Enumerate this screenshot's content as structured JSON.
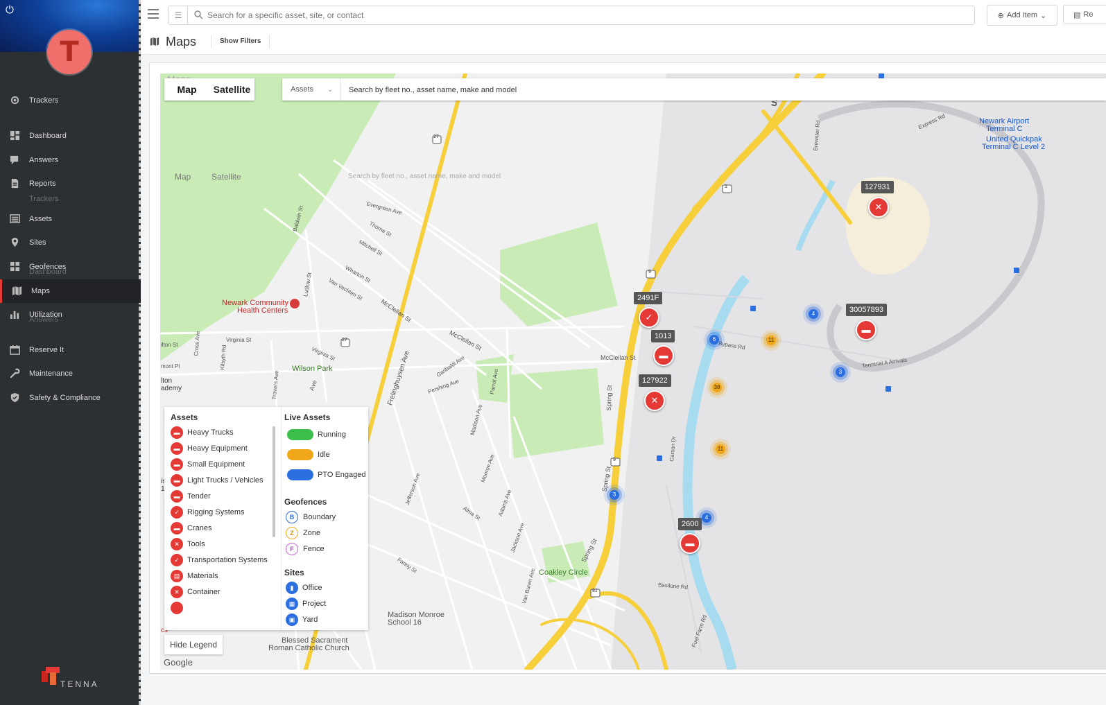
{
  "sidebar": {
    "user_initial": "T",
    "items": [
      {
        "label": "Trackers",
        "icon": "gear-icon"
      },
      {
        "label": "Dashboard",
        "icon": "dashboard-icon"
      },
      {
        "label": "Answers",
        "icon": "chat-icon"
      },
      {
        "label": "Reports",
        "icon": "report-icon"
      },
      {
        "label": "Assets",
        "icon": "assets-icon"
      },
      {
        "label": "Sites",
        "icon": "location-pin-icon"
      },
      {
        "label": "Geofences",
        "icon": "geofence-icon"
      },
      {
        "label": "Maps",
        "icon": "map-icon",
        "active": true
      },
      {
        "label": "Utilization",
        "icon": "chart-icon"
      },
      {
        "label": "Reserve It",
        "icon": "calendar-icon"
      },
      {
        "label": "Maintenance",
        "icon": "wrench-icon"
      },
      {
        "label": "Safety & Compliance",
        "icon": "shield-icon"
      }
    ],
    "ghosts": [
      "Trackers",
      "Dashboard",
      "Answers"
    ],
    "brand": "TENNA"
  },
  "topbar": {
    "search_placeholder": "Search for a specific asset, site, or contact",
    "add_item_label": "Add Item",
    "report_label": "Re"
  },
  "page": {
    "title": "Maps",
    "show_filters_label": "Show Filters"
  },
  "map": {
    "toggle": {
      "map": "Map",
      "satellite": "Satellite"
    },
    "asset_select": "Assets",
    "search_placeholder": "Search by fleet no., asset name, make and model",
    "ghost_text": {
      "maps": "Maps",
      "map": "Map",
      "satellite": "Satellite",
      "search": "Search by fleet no., asset name, make and model"
    },
    "tags": [
      "127931",
      "2491F",
      "1013",
      "127922",
      "30057893",
      "2600"
    ],
    "clusters": [
      {
        "value": "4",
        "color": "blue"
      },
      {
        "value": "6",
        "color": "blue"
      },
      {
        "value": "11",
        "color": "amber"
      },
      {
        "value": "3",
        "color": "blue"
      },
      {
        "value": "38",
        "color": "amber"
      },
      {
        "value": "11",
        "color": "amber"
      },
      {
        "value": "3",
        "color": "blue"
      },
      {
        "value": "4",
        "color": "blue"
      }
    ],
    "places": {
      "newark_community": "Newark Community",
      "health_centers": "Health Centers",
      "wilson_park": "Wilson Park",
      "coakley": "Coakley Circle",
      "madison1": "Madison Monroe",
      "madison2": "School 16",
      "blessed1": "Blessed Sacrament",
      "blessed2": "Roman Catholic Church",
      "airport1": "Newark Airport",
      "airport2": "Terminal C",
      "quickpak1": "United Quickpak",
      "quickpak2": "Terminal C Level 2",
      "hilton1": "lton",
      "hilton2": "ademy",
      "montpl": "mont Pl",
      "hilton_st": "ilton St",
      "is": "is",
      "num18": "18",
      "cs": "cs"
    },
    "streets": {
      "frelinghuysen": "Frelinghuysen Ave",
      "mcclellan": "McClellan St",
      "mcclellan2": "McClellan St",
      "mcclellan3": "McClellan St",
      "virginia": "Virginia St",
      "virginia2": "Virginia St",
      "evergreen": "Evergreen Ave",
      "spring": "Spring St",
      "spring2": "Spring St",
      "spring3": "Spring St",
      "express": "Express Rd",
      "bypass": "Bypass Rd",
      "terminal_a": "Terminal A Arrivals",
      "basilone": "Basilone Rd",
      "route27": "27",
      "route1": "1",
      "route9": "9",
      "route9b": "9",
      "route81": "81",
      "us": "US",
      "ave": "Ave",
      "vanvechten": "Van Vechten St",
      "wharton": "Wharton St",
      "mitchell": "Mitchell St",
      "thorne": "Thorne St",
      "baldwin": "Baldwin St",
      "ludlow": "Ludlow St",
      "kilsyth": "Kilsyth Rd",
      "cross": "Cross Ave",
      "travers": "Travers Ave",
      "garibaldi": "Garibaldi Ave",
      "pershing": "Pershing Ave",
      "parrot": "Parrot Ave",
      "madison": "Madison Ave",
      "jefferson": "Jefferson Ave",
      "monroe": "Monroe Ave",
      "adams": "Adams Ave",
      "jackson": "Jackson Ave",
      "carson": "Carson Dr",
      "fuelfarm": "Fuel Farm Rd",
      "fanny": "Fanny St",
      "alma": "Alma St",
      "vanburen": "Van Buren Ave",
      "brewster": "Brewster Rd"
    }
  },
  "legend": {
    "assets_header": "Assets",
    "assets": [
      "Heavy Trucks",
      "Heavy Equipment",
      "Small Equipment",
      "Light Trucks / Vehicles",
      "Tender",
      "Rigging Systems",
      "Cranes",
      "Tools",
      "Transportation Systems",
      "Materials",
      "Container"
    ],
    "live_header": "Live Assets",
    "live": [
      "Running",
      "Idle",
      "PTO Engaged"
    ],
    "geofences_header": "Geofences",
    "geofences": [
      {
        "letter": "B",
        "label": "Boundary"
      },
      {
        "letter": "Z",
        "label": "Zone"
      },
      {
        "letter": "F",
        "label": "Fence"
      }
    ],
    "sites_header": "Sites",
    "sites": [
      "Office",
      "Project",
      "Yard"
    ],
    "hide_label": "Hide Legend"
  },
  "attribution": "Google",
  "colors": {
    "accent": "#e53935",
    "blue": "#2a6ee0",
    "amber": "#f0a81a",
    "road": "#f6cf3a",
    "park": "#c9ecb7",
    "water": "#a7dbf0"
  }
}
